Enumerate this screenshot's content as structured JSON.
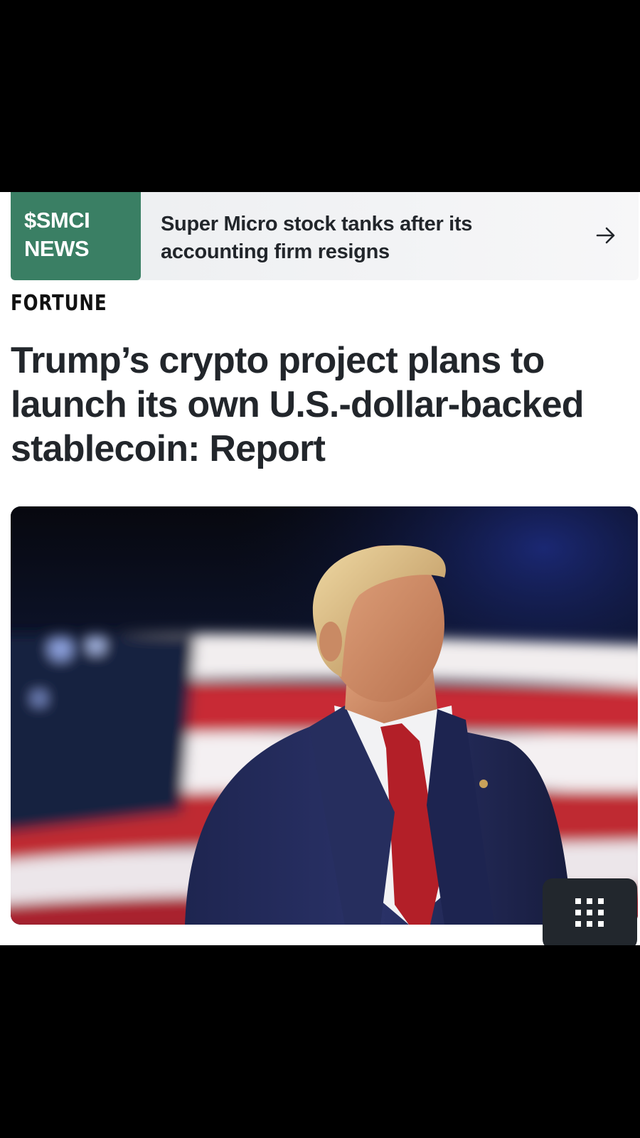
{
  "ticker": {
    "badge_line1": "$SMCI",
    "badge_line2": "NEWS",
    "headline": "Super Micro stock tanks after its accounting firm resigns",
    "arrow_icon": "arrow-right-icon",
    "badge_color": "#3a7f64"
  },
  "brand": {
    "name": "FORTUNE"
  },
  "article": {
    "headline": "Trump’s crypto project plans to launch its own U.S.-dollar-backed stablecoin: Report",
    "hero_image": "photo-of-man-in-suit-before-american-flag"
  },
  "controls": {
    "grid_icon": "grid-menu-icon"
  }
}
